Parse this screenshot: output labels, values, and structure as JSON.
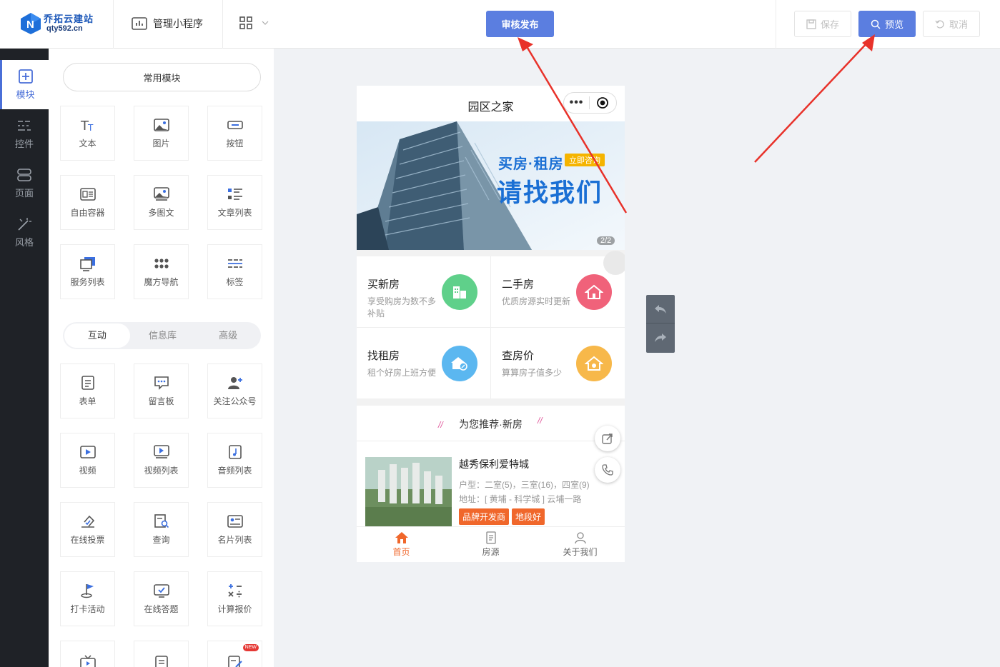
{
  "header": {
    "logo_title": "乔拓云建站",
    "logo_url": "qty592.cn",
    "mini_program_label": "管理小程序",
    "publish_label": "审核发布",
    "save_label": "保存",
    "preview_label": "预览",
    "cancel_label": "取消",
    "accent": "#5b7ee0"
  },
  "sidebar": {
    "items": [
      {
        "label": "模块",
        "icon": "plus-square-icon"
      },
      {
        "label": "控件",
        "icon": "sliders-icon"
      },
      {
        "label": "页面",
        "icon": "pages-icon"
      },
      {
        "label": "风格",
        "icon": "magic-wand-icon"
      }
    ]
  },
  "panel": {
    "common_header": "常用模块",
    "common": [
      {
        "label": "文本",
        "icon": "text-icon"
      },
      {
        "label": "图片",
        "icon": "image-icon"
      },
      {
        "label": "按钮",
        "icon": "button-icon"
      },
      {
        "label": "自由容器",
        "icon": "container-icon"
      },
      {
        "label": "多图文",
        "icon": "multi-image-icon"
      },
      {
        "label": "文章列表",
        "icon": "article-list-icon"
      },
      {
        "label": "服务列表",
        "icon": "service-list-icon"
      },
      {
        "label": "魔方导航",
        "icon": "cube-nav-icon"
      },
      {
        "label": "标签",
        "icon": "tag-icon"
      }
    ],
    "tabs": [
      "互动",
      "信息库",
      "高级"
    ],
    "interactive": [
      {
        "label": "表单",
        "icon": "form-icon"
      },
      {
        "label": "留言板",
        "icon": "message-board-icon"
      },
      {
        "label": "关注公众号",
        "icon": "follow-icon"
      },
      {
        "label": "视频",
        "icon": "video-icon"
      },
      {
        "label": "视频列表",
        "icon": "video-list-icon"
      },
      {
        "label": "音频列表",
        "icon": "audio-list-icon"
      },
      {
        "label": "在线投票",
        "icon": "vote-icon"
      },
      {
        "label": "查询",
        "icon": "query-icon"
      },
      {
        "label": "名片列表",
        "icon": "card-list-icon"
      },
      {
        "label": "打卡活动",
        "icon": "checkin-icon"
      },
      {
        "label": "在线答题",
        "icon": "quiz-icon"
      },
      {
        "label": "计算报价",
        "icon": "calculator-icon"
      }
    ],
    "new_badge": "NEW"
  },
  "phone": {
    "title": "园区之家",
    "banner": {
      "line1": "买房·租房",
      "badge": "立即咨询",
      "line2": "请找我们",
      "counter": "2/2"
    },
    "services": [
      {
        "title": "买新房",
        "desc": "享受购房为数不多补贴",
        "color": "#5fd08a",
        "icon": "building-icon"
      },
      {
        "title": "二手房",
        "desc": "优质房源实时更新",
        "color": "#f0627a",
        "icon": "house-icon"
      },
      {
        "title": "找租房",
        "desc": "租个好房上班方便",
        "color": "#5bb7f0",
        "icon": "rent-house-icon"
      },
      {
        "title": "查房价",
        "desc": "算算房子值多少",
        "color": "#f7b84a",
        "icon": "price-house-icon"
      }
    ],
    "recommend_title": "为您推荐·新房",
    "listing": {
      "name": "越秀保利爱特城",
      "layout": "户型：二室(5)，三室(16)，四室(9)",
      "address": "地址：[ 黄埔 - 科学城 ] 云埔一路",
      "tags": [
        "品牌开发商",
        "地段好"
      ]
    },
    "tabbar": [
      {
        "label": "首页",
        "icon": "home-icon"
      },
      {
        "label": "房源",
        "icon": "doc-icon"
      },
      {
        "label": "关于我们",
        "icon": "user-icon"
      }
    ]
  }
}
